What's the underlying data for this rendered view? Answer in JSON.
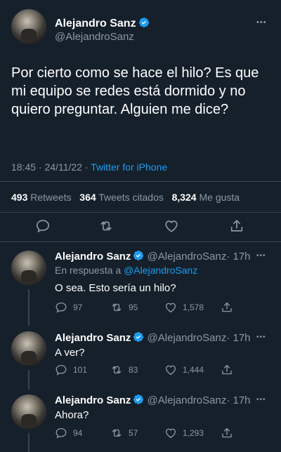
{
  "main_tweet": {
    "author_name": "Alejandro Sanz",
    "handle": "@AlejandroSanz",
    "text": "Por cierto como se hace el hilo? Es que mi equipo se redes está dormido y no quiero preguntar. Alguien me dice?",
    "time": "18:45",
    "date_sep": " · ",
    "date": "24/11/22",
    "source_sep": " · ",
    "source": "Twitter for iPhone",
    "retweets_count": "493",
    "retweets_label": "Retweets",
    "quotes_count": "364",
    "quotes_label": "Tweets citados",
    "likes_count": "8,324",
    "likes_label": "Me gusta"
  },
  "replies": [
    {
      "author_name": "Alejandro Sanz",
      "handle": "@AlejandroSanz",
      "age": "· 17h",
      "reply_to_prefix": "En respuesta a ",
      "reply_to_handle": "@AlejandroSanz",
      "text": "O sea. Esto sería un hilo?",
      "replies_count": "97",
      "retweets_count": "95",
      "likes_count": "1,578"
    },
    {
      "author_name": "Alejandro Sanz",
      "handle": "@AlejandroSanz",
      "age": "· 17h",
      "text": "A ver?",
      "replies_count": "101",
      "retweets_count": "83",
      "likes_count": "1,444"
    },
    {
      "author_name": "Alejandro Sanz",
      "handle": "@AlejandroSanz",
      "age": "· 17h",
      "text": "Ahora?",
      "replies_count": "94",
      "retweets_count": "57",
      "likes_count": "1,293"
    }
  ],
  "more_glyph": "•••",
  "colors": {
    "background": "#15202b",
    "accent": "#1d9bf0",
    "muted": "#8b98a5",
    "divider": "#38444d"
  },
  "icons": {
    "reply": "reply-icon",
    "retweet": "retweet-icon",
    "like": "like-icon",
    "share": "share-icon",
    "verified": "verified-badge-icon",
    "more": "more-icon"
  }
}
